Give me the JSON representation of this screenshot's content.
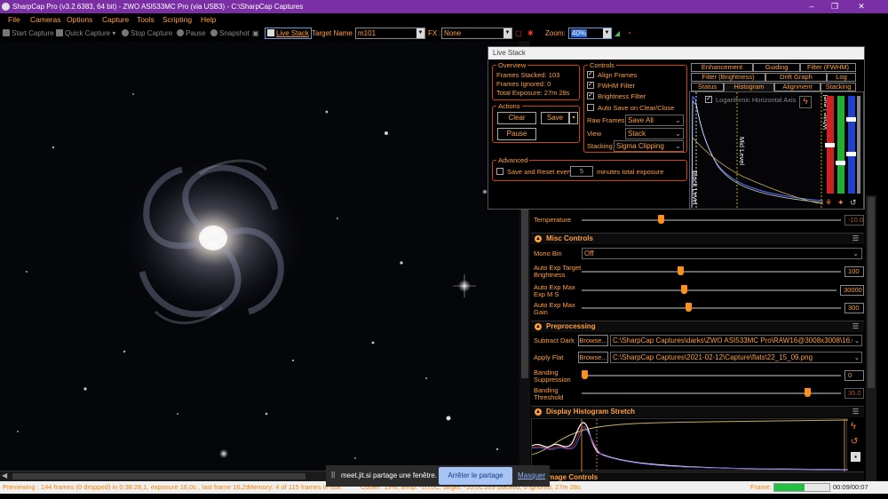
{
  "window": {
    "title": "SharpCap Pro (v3.2.6383, 64 bit) - ZWO ASI533MC Pro (via USB3) - C:\\SharpCap Captures",
    "minimize": "–",
    "maximize": "❐",
    "close": "✕"
  },
  "menu": [
    "File",
    "Cameras",
    "Options",
    "Capture",
    "Tools",
    "Scripting",
    "Help"
  ],
  "toolbar": {
    "start_capture": "Start Capture",
    "quick_capture": "Quick Capture",
    "stop_capture": "Stop Capture",
    "pause": "Pause",
    "snapshot": "Snapshot",
    "live_stack": "Live Stack",
    "target_name_label": "Target Name :",
    "target_name_value": "m101",
    "fx_label": "FX :",
    "fx_value": "None",
    "zoom_label": "Zoom:",
    "zoom_value": "40%"
  },
  "live_stack": {
    "title": "Live Stack",
    "overview": {
      "title": "Overview",
      "frames_stacked": "Frames Stacked: 103",
      "frames_ignored": "Frames Ignored: 0",
      "total_exposure": "Total Exposure: 27m 28s"
    },
    "actions": {
      "title": "Actions",
      "clear": "Clear",
      "save": "Save",
      "pause": "Pause"
    },
    "controls": {
      "title": "Controls",
      "align_frames": "Align Frames",
      "fwhm_filter": "FWHM Filter",
      "brightness_filter": "Brightness Filter",
      "auto_save": "Auto Save on Clear/Close",
      "raw_frames_label": "Raw Frames",
      "raw_frames_value": "Save All",
      "view_label": "View",
      "view_value": "Stack",
      "stacking_label": "Stacking",
      "stacking_value": "Sigma Clipping"
    },
    "advanced": {
      "title": "Advanced",
      "save_reset_label": "Save and Reset every",
      "save_reset_value": "5",
      "save_reset_suffix": "minutes total exposure"
    },
    "tabs_row1": [
      "Enhancement",
      "Guiding",
      "Filter (FWHM)"
    ],
    "tabs_row2": [
      "Filter (Brightness)",
      "Drift Graph",
      "Log"
    ],
    "tabs_row3": [
      "Status",
      "Histogram",
      "Alignment",
      "Stacking"
    ],
    "histogram": {
      "log_axis": "Logarithmic Horizontal Axis",
      "black_level": "Black Level",
      "mid_level": "Mid Level",
      "white_level": "White Level"
    }
  },
  "camera_controls": {
    "temperature_label": "Temperature",
    "temperature_value": "-10.0",
    "temperature_level": 0.3,
    "misc_title": "Misc Controls",
    "mono_bin_label": "Mono Bin",
    "mono_bin_value": "Off",
    "auto_exp_target_label": "Auto Exp Target Brightness",
    "auto_exp_target_value": "100",
    "auto_exp_target_level": 0.38,
    "auto_exp_max_ms_label": "Auto Exp Max Exp M S",
    "auto_exp_max_ms_value": "30000",
    "auto_exp_max_ms_level": 0.4,
    "auto_exp_max_gain_label": "Auto Exp Max Gain",
    "auto_exp_max_gain_value": "300",
    "auto_exp_max_gain_level": 0.41,
    "preprocessing_title": "Preprocessing",
    "subtract_dark_label": "Subtract Dark",
    "subtract_dark_value": "C:\\SharpCap Captures\\darks\\ZWO ASI533MC Pro\\RAW16@3008x3008\\16.0s\\gain...",
    "apply_flat_label": "Apply Flat",
    "apply_flat_value": "C:\\SharpCap Captures\\2021-02-12\\Capture\\flats\\22_15_09.png",
    "browse": "Browse...",
    "banding_supp_label": "Banding Suppression",
    "banding_supp_value": "0",
    "banding_supp_level": 0.0,
    "banding_thresh_label": "Banding Threshold",
    "banding_thresh_value": "35.0",
    "banding_thresh_level": 0.88,
    "display_stretch_title": "Display Histogram Stretch",
    "color_controls_title": "Image Controls"
  },
  "status": {
    "preview": "Previewing : 144 frames (0 dropped) in 0:38:28,1, exposure 16,0s , last frame 16,2s",
    "memory": "Memory: 4 of 115 frames in use.",
    "camera": "Cooler: 15%, temp: -10,0C, target: -10,0C",
    "stack": "103 stacked, 0 ignored, 27m 28s",
    "frame_label": "Frame:",
    "frame_progress": 0.55,
    "frame_time": "00:09/00:07"
  },
  "share_bar": {
    "message": "meet.jit.si partage une fenêtre.",
    "stop": "Arrêter le partage",
    "hide": "Masquer"
  },
  "colors": {
    "accent": "#ffa040",
    "title_bar": "#7a2fa5",
    "frame_bar": "#22c040"
  },
  "icons": [
    "camera-icon",
    "quick-capture-icon",
    "stop-icon",
    "pause-icon",
    "snapshot-icon",
    "live-stack-icon",
    "record-icon",
    "zoom-icon",
    "histogram-icon",
    "refresh-icon"
  ]
}
